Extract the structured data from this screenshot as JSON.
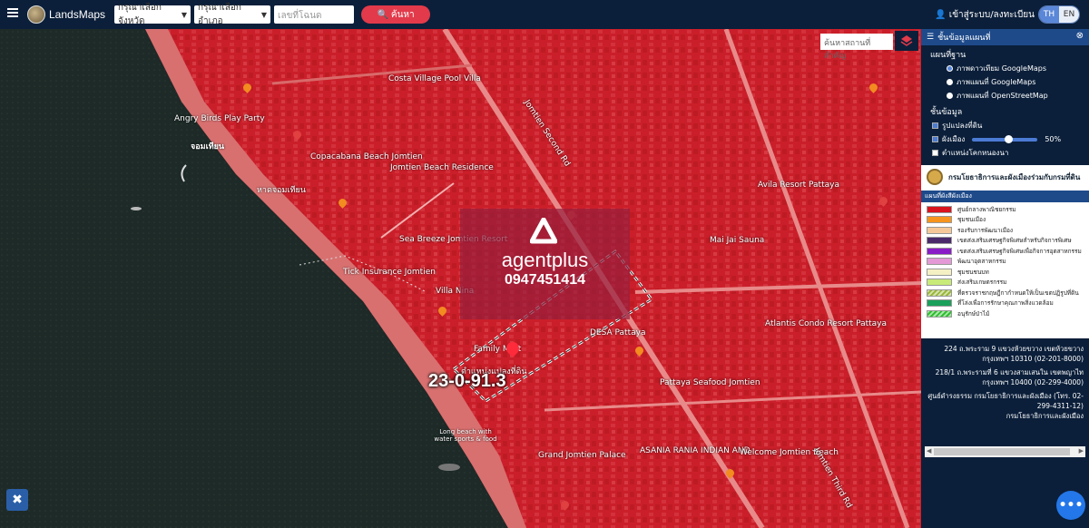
{
  "header": {
    "brand": "LandsMaps",
    "province_placeholder": "กรุณาเลือกจังหวัด",
    "district_placeholder": "กรุณาเลือกอำเภอ",
    "deed_placeholder": "เลขที่โฉนด",
    "search_label": "ค้นหา",
    "login_label": "เข้าสู่ระบบ/ลงทะเบียน",
    "lang_th": "TH",
    "lang_en": "EN"
  },
  "map": {
    "search_place_placeholder": "ค้นหาสถานที่สำคัญ",
    "watermark_name": "agentplus",
    "watermark_phone": "0947451414",
    "parcel_area": "23-0-91.3",
    "parcel_label": "ตำแหน่งแปลงที่ดิน",
    "labels": [
      "Angry Birds Play Party",
      "จอมเทียน",
      "หาดจอมเทียน",
      "Copacabana Beach Jomtien",
      "Costa Village Pool Villa",
      "Jomtien Beach Residence",
      "Tick Insurance Jomtien",
      "Villa Nina",
      "Sea Breeze Jomtien Resort",
      "Atlantis Condo Resort Pattaya",
      "Avila Resort Pattaya",
      "Grand Jomtien Palace",
      "ASANIA RANIA INDIAN AND",
      "Pattaya Seafood Jomtien",
      "Mai Jai Sauna",
      "Long beach with water sports & food",
      "DESA Pattaya",
      "Family Mart",
      "Welcome Jomtien Beach",
      "Jomtien Second Rd",
      "Jomtien Third Rd"
    ]
  },
  "panel": {
    "title": "ชั้นข้อมูลแผนที่",
    "basemap_title": "แผนที่ฐาน",
    "basemaps": [
      {
        "label": "ภาพดาวเทียม GoogleMaps",
        "selected": true
      },
      {
        "label": "ภาพแผนที่ GoogleMaps",
        "selected": false
      },
      {
        "label": "ภาพแผนที่ OpenStreetMap",
        "selected": false
      }
    ],
    "layers_title": "ชั้นข้อมูล",
    "layers": [
      {
        "label": "รูปแปลงที่ดิน",
        "checked": true
      },
      {
        "label": "ผังเมือง",
        "checked": true,
        "opacity": "50%",
        "opacity_value": 0.5
      },
      {
        "label": "ตำแหน่งโคกหนองนา",
        "checked": false
      }
    ],
    "dept_name": "กรมโยธาธิการและผังเมืองร่วมกับกรมที่ดิน",
    "legend_title": "แผนที่ผังสีผังเมือง",
    "legend": [
      {
        "label": "ศูนย์กลางพาณิชยกรรม",
        "color": "#d9141c"
      },
      {
        "label": "ชุมชนเมือง",
        "color": "#f7941d"
      },
      {
        "label": "รองรับการพัฒนาเมือง",
        "color": "#f5c89a"
      },
      {
        "label": "เขตส่งเสริมเศรษฐกิจพิเศษสำหรับกิจการพิเศษ",
        "color": "#4a2a6b"
      },
      {
        "label": "เขตส่งเสริมเศรษฐกิจพิเศษเพื่อกิจการอุตสาหกรรม",
        "color": "#8a1cc8"
      },
      {
        "label": "พัฒนาอุตสาหกรรม",
        "color": "#e39ad6"
      },
      {
        "label": "ชุมชนชนบท",
        "color": "#f4f0c4"
      },
      {
        "label": "ส่งเสริมเกษตรกรรม",
        "color": "#c8ea78"
      },
      {
        "label": "ที่ตรวจราชกฤษฎีกากำหนดให้เป็นเขตปฏิรูปที่ดิน",
        "color": "#9ab83a"
      },
      {
        "label": "ที่โล่งเพื่อการรักษาคุณภาพสิ่งแวดล้อม",
        "color": "#1aa05a"
      },
      {
        "label": "อนุรักษ์ป่าไม้",
        "color": "#2fbf2f"
      }
    ],
    "contact_1": "224 ถ.พระราม 9 แขวงห้วยขวาง เขตห้วยขวาง กรุงเทพฯ 10310 (02-201-8000)",
    "contact_2": "218/1 ถ.พระรามที่ 6 แขวงสามเสนใน เขตพญาไท กรุงเทพฯ 10400 (02-299-4000)",
    "contact_3": "ศูนย์ดำรงธรรม กรมโยธาธิการและผังเมือง (โทร. 02-299-4311-12)",
    "contact_4": "กรมโยธาธิการและผังเมือง"
  },
  "colors": {
    "topbar": "#0b1f3a",
    "search_button": "#e23a4a",
    "overlay_red": "#d9141c",
    "accent_blue": "#2477e8"
  },
  "icons": [
    "hamburger-icon",
    "logo-icon",
    "search-icon",
    "user-icon",
    "layers-icon",
    "close-icon",
    "map-tool-icon",
    "chat-icon"
  ]
}
